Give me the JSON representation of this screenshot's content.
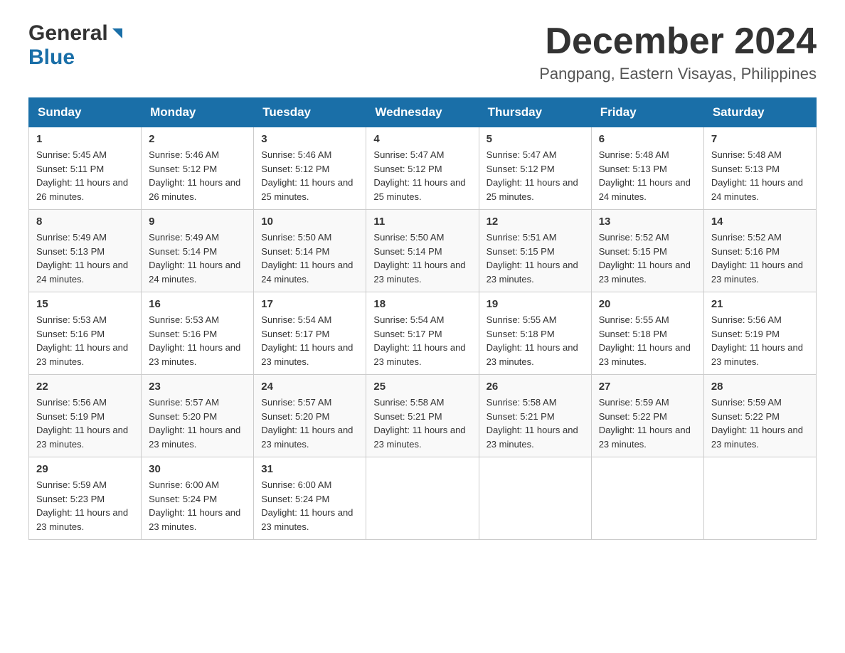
{
  "logo": {
    "general": "General",
    "blue": "Blue"
  },
  "title": {
    "month_year": "December 2024",
    "location": "Pangpang, Eastern Visayas, Philippines"
  },
  "weekdays": [
    "Sunday",
    "Monday",
    "Tuesday",
    "Wednesday",
    "Thursday",
    "Friday",
    "Saturday"
  ],
  "weeks": [
    [
      {
        "day": "1",
        "sunrise": "5:45 AM",
        "sunset": "5:11 PM",
        "daylight": "11 hours and 26 minutes."
      },
      {
        "day": "2",
        "sunrise": "5:46 AM",
        "sunset": "5:12 PM",
        "daylight": "11 hours and 26 minutes."
      },
      {
        "day": "3",
        "sunrise": "5:46 AM",
        "sunset": "5:12 PM",
        "daylight": "11 hours and 25 minutes."
      },
      {
        "day": "4",
        "sunrise": "5:47 AM",
        "sunset": "5:12 PM",
        "daylight": "11 hours and 25 minutes."
      },
      {
        "day": "5",
        "sunrise": "5:47 AM",
        "sunset": "5:12 PM",
        "daylight": "11 hours and 25 minutes."
      },
      {
        "day": "6",
        "sunrise": "5:48 AM",
        "sunset": "5:13 PM",
        "daylight": "11 hours and 24 minutes."
      },
      {
        "day": "7",
        "sunrise": "5:48 AM",
        "sunset": "5:13 PM",
        "daylight": "11 hours and 24 minutes."
      }
    ],
    [
      {
        "day": "8",
        "sunrise": "5:49 AM",
        "sunset": "5:13 PM",
        "daylight": "11 hours and 24 minutes."
      },
      {
        "day": "9",
        "sunrise": "5:49 AM",
        "sunset": "5:14 PM",
        "daylight": "11 hours and 24 minutes."
      },
      {
        "day": "10",
        "sunrise": "5:50 AM",
        "sunset": "5:14 PM",
        "daylight": "11 hours and 24 minutes."
      },
      {
        "day": "11",
        "sunrise": "5:50 AM",
        "sunset": "5:14 PM",
        "daylight": "11 hours and 23 minutes."
      },
      {
        "day": "12",
        "sunrise": "5:51 AM",
        "sunset": "5:15 PM",
        "daylight": "11 hours and 23 minutes."
      },
      {
        "day": "13",
        "sunrise": "5:52 AM",
        "sunset": "5:15 PM",
        "daylight": "11 hours and 23 minutes."
      },
      {
        "day": "14",
        "sunrise": "5:52 AM",
        "sunset": "5:16 PM",
        "daylight": "11 hours and 23 minutes."
      }
    ],
    [
      {
        "day": "15",
        "sunrise": "5:53 AM",
        "sunset": "5:16 PM",
        "daylight": "11 hours and 23 minutes."
      },
      {
        "day": "16",
        "sunrise": "5:53 AM",
        "sunset": "5:16 PM",
        "daylight": "11 hours and 23 minutes."
      },
      {
        "day": "17",
        "sunrise": "5:54 AM",
        "sunset": "5:17 PM",
        "daylight": "11 hours and 23 minutes."
      },
      {
        "day": "18",
        "sunrise": "5:54 AM",
        "sunset": "5:17 PM",
        "daylight": "11 hours and 23 minutes."
      },
      {
        "day": "19",
        "sunrise": "5:55 AM",
        "sunset": "5:18 PM",
        "daylight": "11 hours and 23 minutes."
      },
      {
        "day": "20",
        "sunrise": "5:55 AM",
        "sunset": "5:18 PM",
        "daylight": "11 hours and 23 minutes."
      },
      {
        "day": "21",
        "sunrise": "5:56 AM",
        "sunset": "5:19 PM",
        "daylight": "11 hours and 23 minutes."
      }
    ],
    [
      {
        "day": "22",
        "sunrise": "5:56 AM",
        "sunset": "5:19 PM",
        "daylight": "11 hours and 23 minutes."
      },
      {
        "day": "23",
        "sunrise": "5:57 AM",
        "sunset": "5:20 PM",
        "daylight": "11 hours and 23 minutes."
      },
      {
        "day": "24",
        "sunrise": "5:57 AM",
        "sunset": "5:20 PM",
        "daylight": "11 hours and 23 minutes."
      },
      {
        "day": "25",
        "sunrise": "5:58 AM",
        "sunset": "5:21 PM",
        "daylight": "11 hours and 23 minutes."
      },
      {
        "day": "26",
        "sunrise": "5:58 AM",
        "sunset": "5:21 PM",
        "daylight": "11 hours and 23 minutes."
      },
      {
        "day": "27",
        "sunrise": "5:59 AM",
        "sunset": "5:22 PM",
        "daylight": "11 hours and 23 minutes."
      },
      {
        "day": "28",
        "sunrise": "5:59 AM",
        "sunset": "5:22 PM",
        "daylight": "11 hours and 23 minutes."
      }
    ],
    [
      {
        "day": "29",
        "sunrise": "5:59 AM",
        "sunset": "5:23 PM",
        "daylight": "11 hours and 23 minutes."
      },
      {
        "day": "30",
        "sunrise": "6:00 AM",
        "sunset": "5:24 PM",
        "daylight": "11 hours and 23 minutes."
      },
      {
        "day": "31",
        "sunrise": "6:00 AM",
        "sunset": "5:24 PM",
        "daylight": "11 hours and 23 minutes."
      },
      null,
      null,
      null,
      null
    ]
  ],
  "labels": {
    "sunrise": "Sunrise:",
    "sunset": "Sunset:",
    "daylight": "Daylight:"
  }
}
